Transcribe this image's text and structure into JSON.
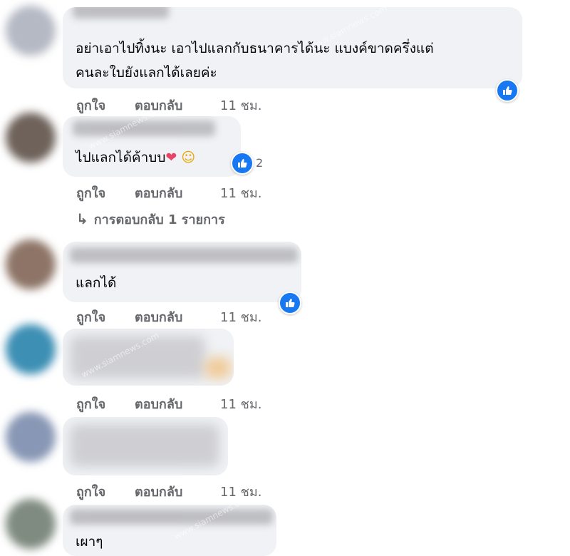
{
  "comments": [
    {
      "text_lines": [
        "อย่าเอาไปทิ้งนะ เอาไปแลกกับธนาคารได้นะ แบงค์ขาดครึ่งแต่",
        "คนละใบยังแลกได้เลยค่ะ"
      ],
      "like_label": "ถูกใจ",
      "reply_label": "ตอบกลับ",
      "time": "11 ชม."
    },
    {
      "text": "ไปแลกได้ค้าบบ",
      "emoji_heart": "❤",
      "emoji_smile": "☺",
      "reaction_count": "2",
      "like_label": "ถูกใจ",
      "reply_label": "ตอบกลับ",
      "time": "11 ชม.",
      "replies_label": "การตอบกลับ 1 รายการ"
    },
    {
      "text": "แลกได้",
      "like_label": "ถูกใจ",
      "reply_label": "ตอบกลับ",
      "time": "11 ชม."
    },
    {
      "like_label": "ถูกใจ",
      "reply_label": "ตอบกลับ",
      "time": "11 ชม."
    },
    {
      "like_label": "ถูกใจ",
      "reply_label": "ตอบกลับ",
      "time": "11 ชม."
    },
    {
      "text": "เผาๆ"
    }
  ],
  "watermark": "www.siamnews.com",
  "icons": {
    "like": "thumbs-up-icon",
    "reply_arrow": "reply-arrow-icon"
  },
  "colors": {
    "bubble": "#f0f2f5",
    "meta": "#65676b",
    "like_blue": "#1877f2"
  }
}
